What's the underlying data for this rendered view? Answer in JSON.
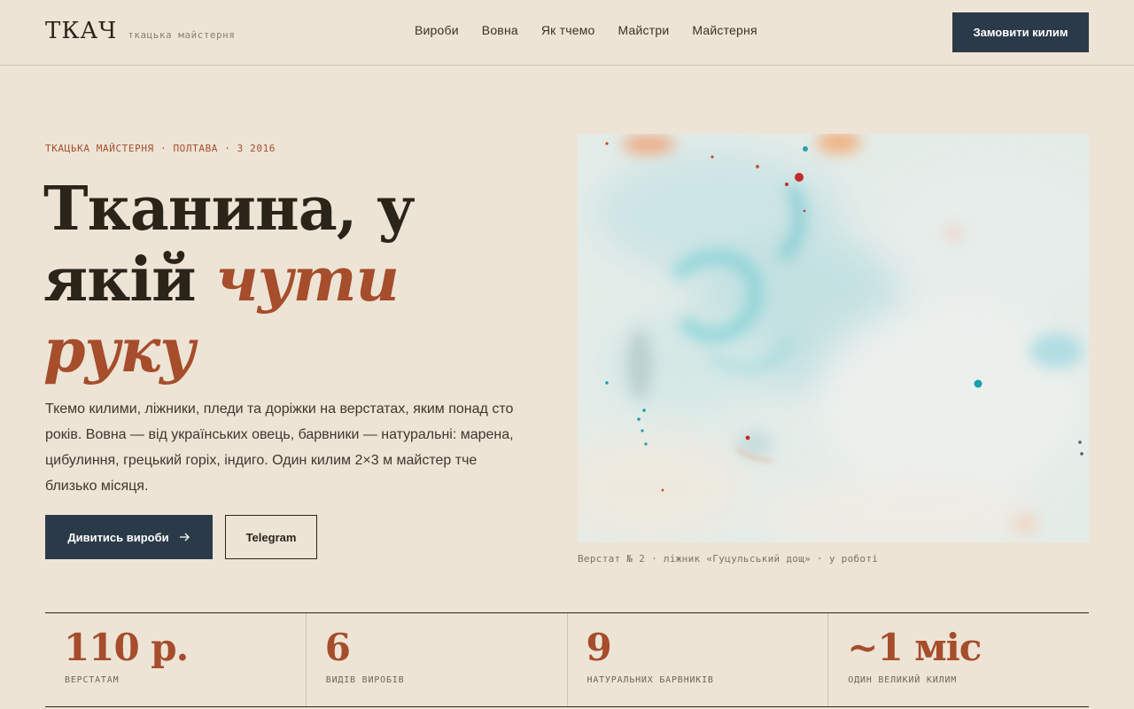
{
  "header": {
    "logo": "ТКАЧ",
    "logo_sub": "ткацька майстерня",
    "nav": [
      "Вироби",
      "Вовна",
      "Як тчемо",
      "Майстри",
      "Майстерня"
    ],
    "cta": "Замовити килим"
  },
  "hero": {
    "eyebrow": "ТКАЦЬКА МАЙСТЕРНЯ · ПОЛТАВА · З 2016",
    "headline_line1": "Тканина, у",
    "headline_line2": "якій",
    "headline_accent1": "чути",
    "headline_accent2": "руку",
    "lead": "Ткемо килими, ліжники, пледи та доріжки на верстатах, яким понад сто років. Вовна — від українських овець, барвники — натуральні: марена, цибулиння, грецький горіх, індиго. Один килим 2×3 м майстер тче близько місяця.",
    "btn_primary": "Дивитись вироби",
    "btn_primary_icon": "arrow-right-icon",
    "btn_secondary": "Telegram",
    "image_caption": "Верстат № 2 · ліжник «Гуцульський дощ» · у роботі"
  },
  "colors": {
    "background": "#ede4d6",
    "accent": "#a64d2c",
    "primary": "#2b3a48",
    "text": "#2a2419"
  },
  "stats": [
    {
      "value": "110 р.",
      "label": "ВЕРСТАТАМ"
    },
    {
      "value": "6",
      "label": "ВИДІВ ВИРОБІВ"
    },
    {
      "value": "9",
      "label": "НАТУРАЛЬНИХ БАРВНИКІВ"
    },
    {
      "value": "~1 міс",
      "label": "ОДИН ВЕЛИКИЙ КИЛИМ"
    }
  ]
}
